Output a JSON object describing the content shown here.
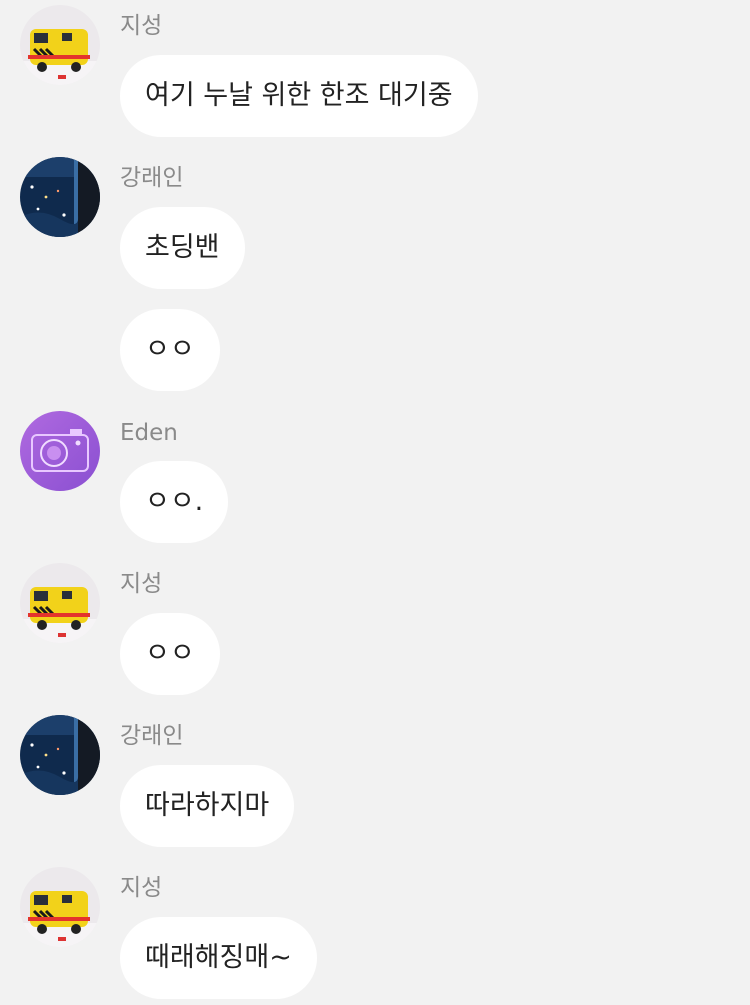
{
  "messages": [
    {
      "sender": "지성",
      "text": "여기 누날 위한 한조 대기중",
      "avatar": "ambulance-toy-avatar"
    },
    {
      "sender": "강래인",
      "text": "초딩밴",
      "avatar": "night-sky-avatar"
    },
    {
      "sender": "",
      "text": "ㅇㅇ"
    },
    {
      "sender": "Eden",
      "text": "ㅇㅇ.",
      "avatar": "camera-avatar"
    },
    {
      "sender": "지성",
      "text": "ㅇㅇ",
      "avatar": "ambulance-toy-avatar"
    },
    {
      "sender": "강래인",
      "text": "따라하지마",
      "avatar": "night-sky-avatar"
    },
    {
      "sender": "지성",
      "text": "때래해징매~",
      "avatar": "ambulance-toy-avatar"
    }
  ],
  "colors": {
    "background": "#f2f2f2",
    "bubble": "#ffffff",
    "sender_text": "#8a8a8a",
    "message_text": "#222222"
  }
}
